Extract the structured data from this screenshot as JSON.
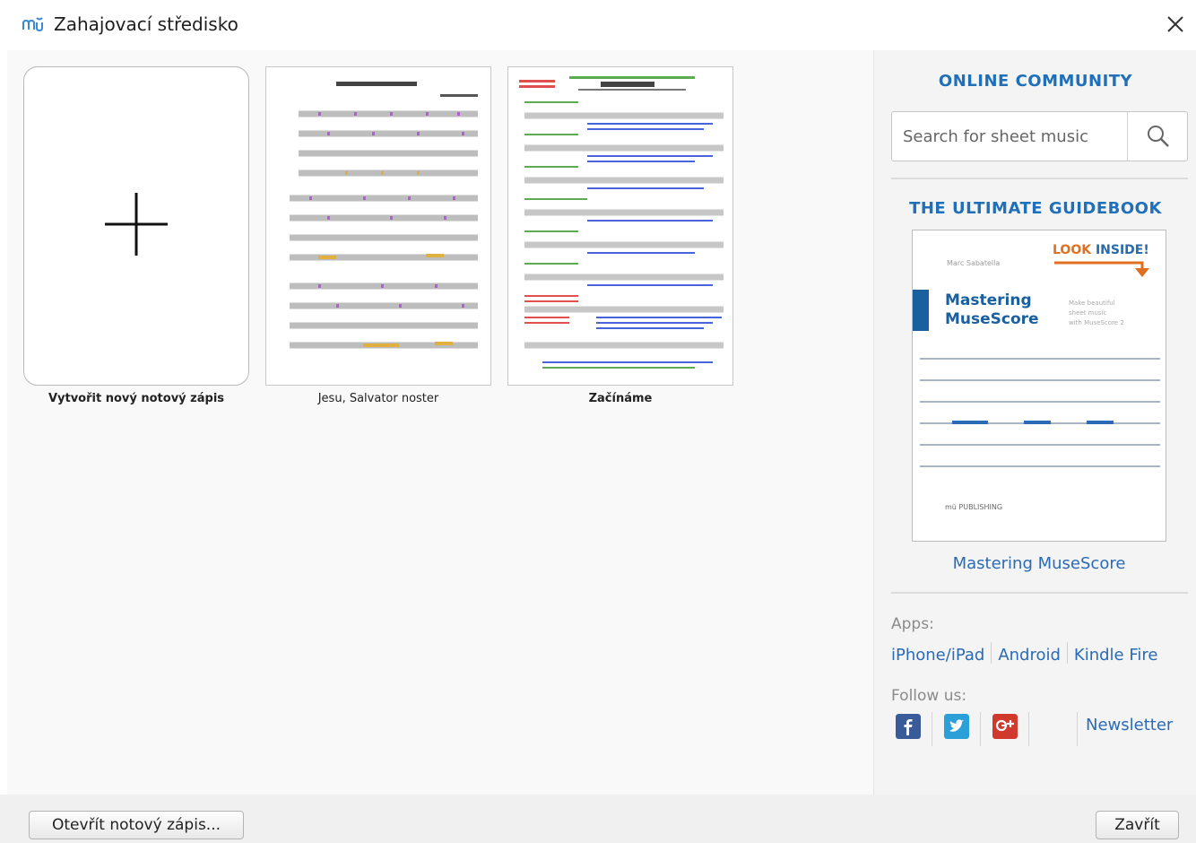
{
  "window": {
    "title": "Zahajovací středisko"
  },
  "tiles": [
    {
      "label": "Vytvořit nový notový zápis"
    },
    {
      "label": "Jesu, Salvator noster"
    },
    {
      "label": "Začínáme"
    }
  ],
  "sidebar": {
    "community_heading": "ONLINE COMMUNITY",
    "search_placeholder": "Search for sheet music",
    "guide_heading": "THE ULTIMATE GUIDEBOOK",
    "book": {
      "author": "Marc Sabatella",
      "look_inside_a": "LOOK ",
      "look_inside_b": "INSIDE!",
      "title": "Mastering\nMuseScore",
      "subtitle": "Make beautiful\nsheet music\nwith MuseScore 2",
      "publisher": "mŭ PUBLISHING"
    },
    "book_link": "Mastering MuseScore",
    "apps_label": "Apps:",
    "apps": [
      "iPhone/iPad",
      "Android",
      "Kindle Fire"
    ],
    "follow_label": "Follow us:",
    "newsletter": "Newsletter"
  },
  "footer": {
    "open_label": "Otevřít notový zápis...",
    "close_label": "Zavřít"
  },
  "colors": {
    "accent": "#1f6fb9",
    "link": "#2a6ab6"
  }
}
